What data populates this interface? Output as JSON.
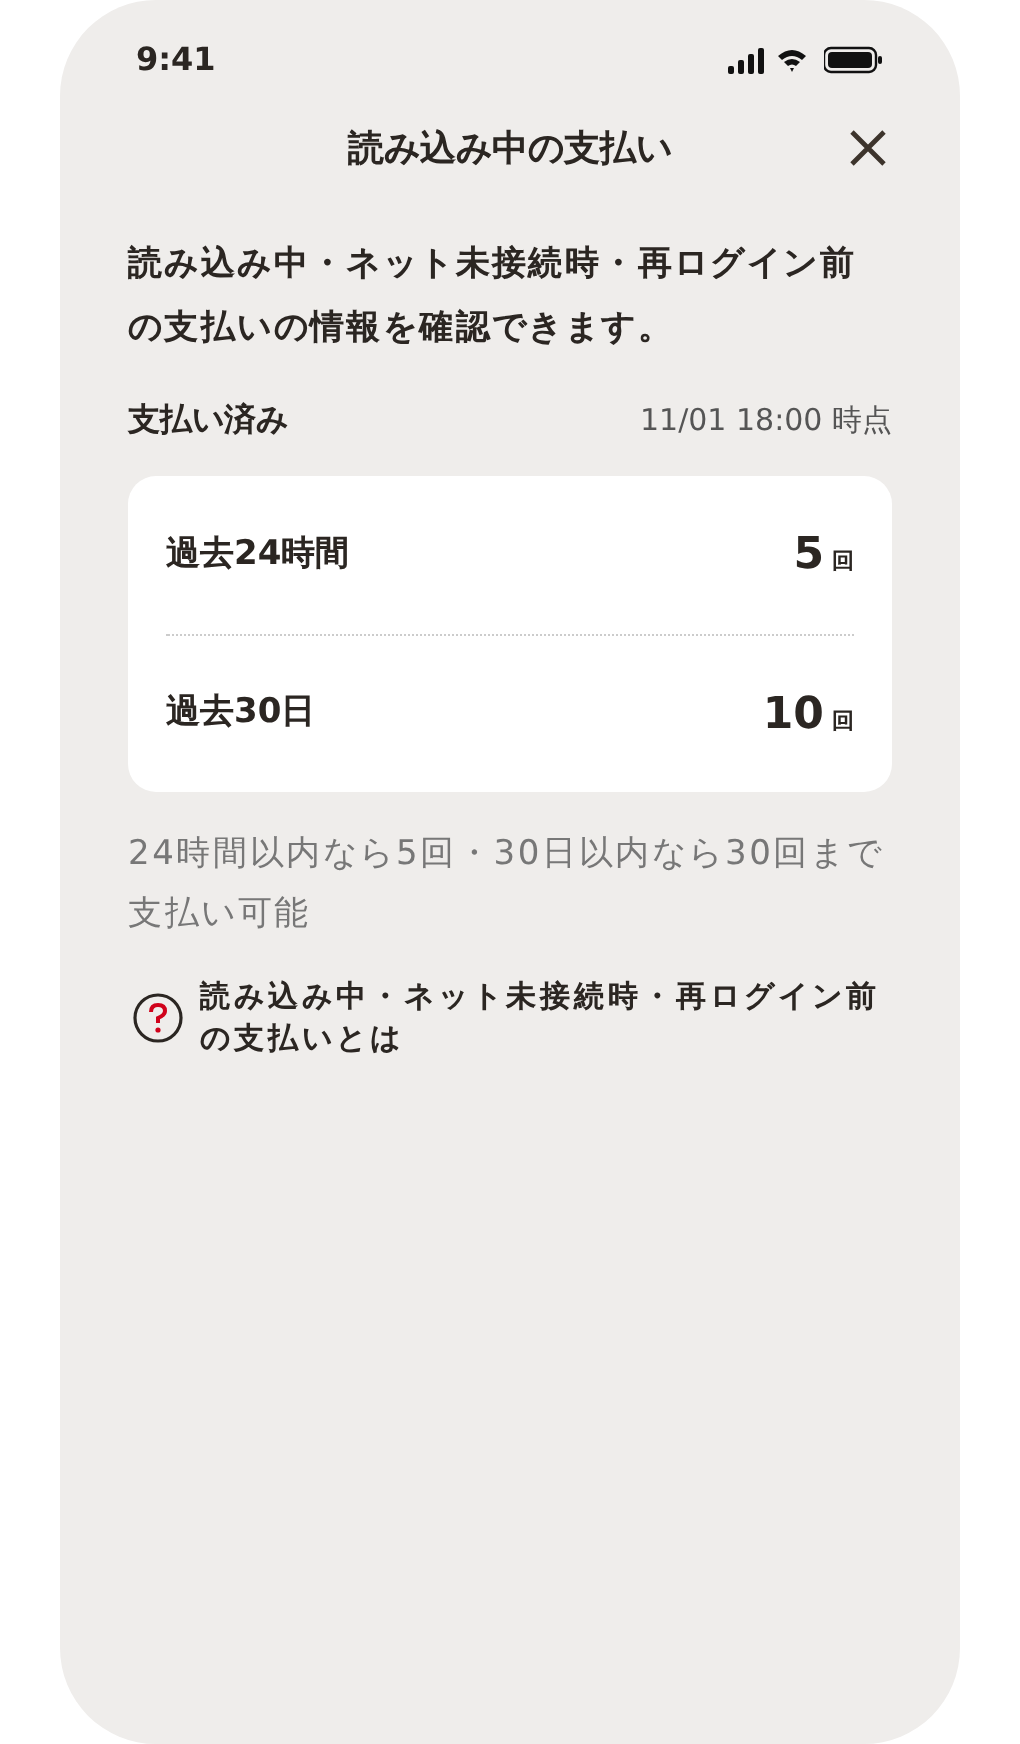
{
  "status_bar": {
    "time": "9:41"
  },
  "header": {
    "title": "読み込み中の支払い"
  },
  "description": "読み込み中・ネット未接続時・再ログイン前の支払いの情報を確認できます。",
  "summary": {
    "label": "支払い済み",
    "as_of": "11/01 18:00 時点"
  },
  "counts": [
    {
      "period": "過去24時間",
      "value": "5",
      "unit": "回"
    },
    {
      "period": "過去30日",
      "value": "10",
      "unit": "回"
    }
  ],
  "note": "24時間以内なら5回・30日以内なら30回まで支払い可能",
  "help_link": {
    "label": "読み込み中・ネット未接続時・再ログイン前の支払いとは"
  }
}
